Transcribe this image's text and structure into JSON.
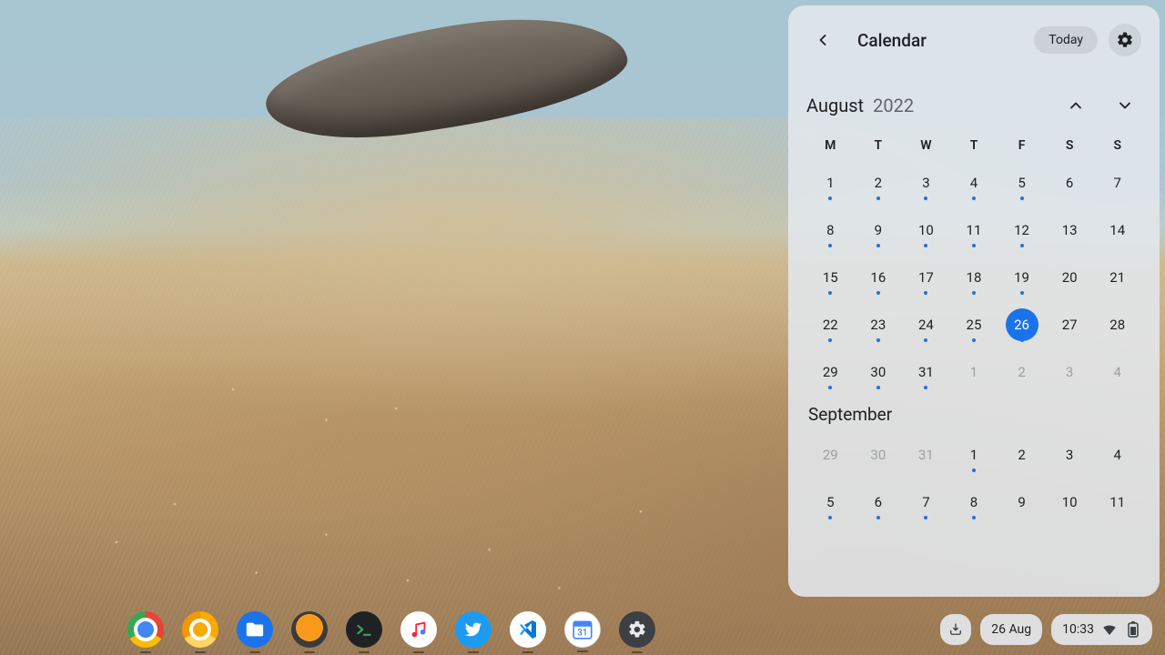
{
  "calendar": {
    "title": "Calendar",
    "today_label": "Today",
    "month1": {
      "name": "August",
      "year": "2022"
    },
    "month2": {
      "name": "September"
    },
    "dow": [
      "M",
      "T",
      "W",
      "T",
      "F",
      "S",
      "S"
    ],
    "grid1": [
      {
        "n": "1",
        "dot": true
      },
      {
        "n": "2",
        "dot": true
      },
      {
        "n": "3",
        "dot": true
      },
      {
        "n": "4",
        "dot": true
      },
      {
        "n": "5",
        "dot": true
      },
      {
        "n": "6"
      },
      {
        "n": "7"
      },
      {
        "n": "8",
        "dot": true
      },
      {
        "n": "9",
        "dot": true
      },
      {
        "n": "10",
        "dot": true
      },
      {
        "n": "11",
        "dot": true
      },
      {
        "n": "12",
        "dot": true
      },
      {
        "n": "13"
      },
      {
        "n": "14"
      },
      {
        "n": "15",
        "dot": true
      },
      {
        "n": "16",
        "dot": true
      },
      {
        "n": "17",
        "dot": true
      },
      {
        "n": "18",
        "dot": true
      },
      {
        "n": "19",
        "dot": true
      },
      {
        "n": "20"
      },
      {
        "n": "21"
      },
      {
        "n": "22",
        "dot": true
      },
      {
        "n": "23",
        "dot": true
      },
      {
        "n": "24",
        "dot": true
      },
      {
        "n": "25",
        "dot": true
      },
      {
        "n": "26",
        "dot": true,
        "today": true
      },
      {
        "n": "27"
      },
      {
        "n": "28"
      },
      {
        "n": "29",
        "dot": true
      },
      {
        "n": "30",
        "dot": true
      },
      {
        "n": "31",
        "dot": true
      },
      {
        "n": "1",
        "other": true
      },
      {
        "n": "2",
        "other": true
      },
      {
        "n": "3",
        "other": true
      },
      {
        "n": "4",
        "other": true
      }
    ],
    "grid2": [
      {
        "n": "29",
        "other": true
      },
      {
        "n": "30",
        "other": true
      },
      {
        "n": "31",
        "other": true
      },
      {
        "n": "1",
        "dot": true
      },
      {
        "n": "2"
      },
      {
        "n": "3"
      },
      {
        "n": "4"
      },
      {
        "n": "5",
        "dot": true
      },
      {
        "n": "6",
        "dot": true
      },
      {
        "n": "7",
        "dot": true
      },
      {
        "n": "8",
        "dot": true
      },
      {
        "n": "9"
      },
      {
        "n": "10"
      },
      {
        "n": "11"
      }
    ]
  },
  "shelf": {
    "apps": [
      {
        "name": "chrome",
        "label": "Google Chrome"
      },
      {
        "name": "chrome-canary",
        "label": "Chrome Canary"
      },
      {
        "name": "files",
        "label": "Files"
      },
      {
        "name": "sublime",
        "label": "Sublime Text"
      },
      {
        "name": "terminal",
        "label": "Terminal"
      },
      {
        "name": "apple-music",
        "label": "Apple Music"
      },
      {
        "name": "twitter",
        "label": "Twitter"
      },
      {
        "name": "vscode",
        "label": "Visual Studio Code"
      },
      {
        "name": "google-calendar",
        "label": "Google Calendar"
      },
      {
        "name": "settings",
        "label": "Settings"
      }
    ]
  },
  "tray": {
    "date": "26 Aug",
    "time": "10:33"
  },
  "colors": {
    "accent": "#1a73e8"
  }
}
